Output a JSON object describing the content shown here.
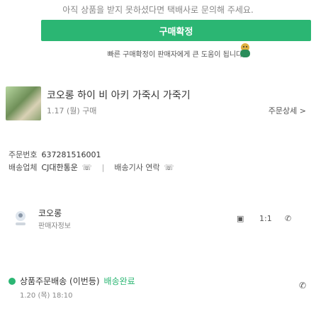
{
  "notice": "아직 상품을 받지 못하셨다면 택배사로 문의해 주세요.",
  "buy_button": "구매확정",
  "tip": {
    "prefix": "빠른 구매확정이 판매자에게 큰 도움이 됩니다.",
    "highlight": ""
  },
  "product": {
    "title": "코오롱 하이 비 아키 가죽시 가죽기",
    "date": "1.17 (월) 구매",
    "detail": "주문상세 >"
  },
  "order": {
    "no_label": "주문번호",
    "no_value": "637281516001",
    "ship_label": "배송업체",
    "ship_value": "CJ대한통운",
    "driver_label": "배송기사 연락",
    "phone_icon": "phone-icon"
  },
  "seller": {
    "name": "코오롱",
    "sub": "판매자정보",
    "actions": [
      "채팅",
      "1:1",
      "전화"
    ]
  },
  "status": {
    "text": "상품주문배송 (이번등)",
    "small": "배송완료",
    "date": "1.20 (목) 18:10"
  }
}
